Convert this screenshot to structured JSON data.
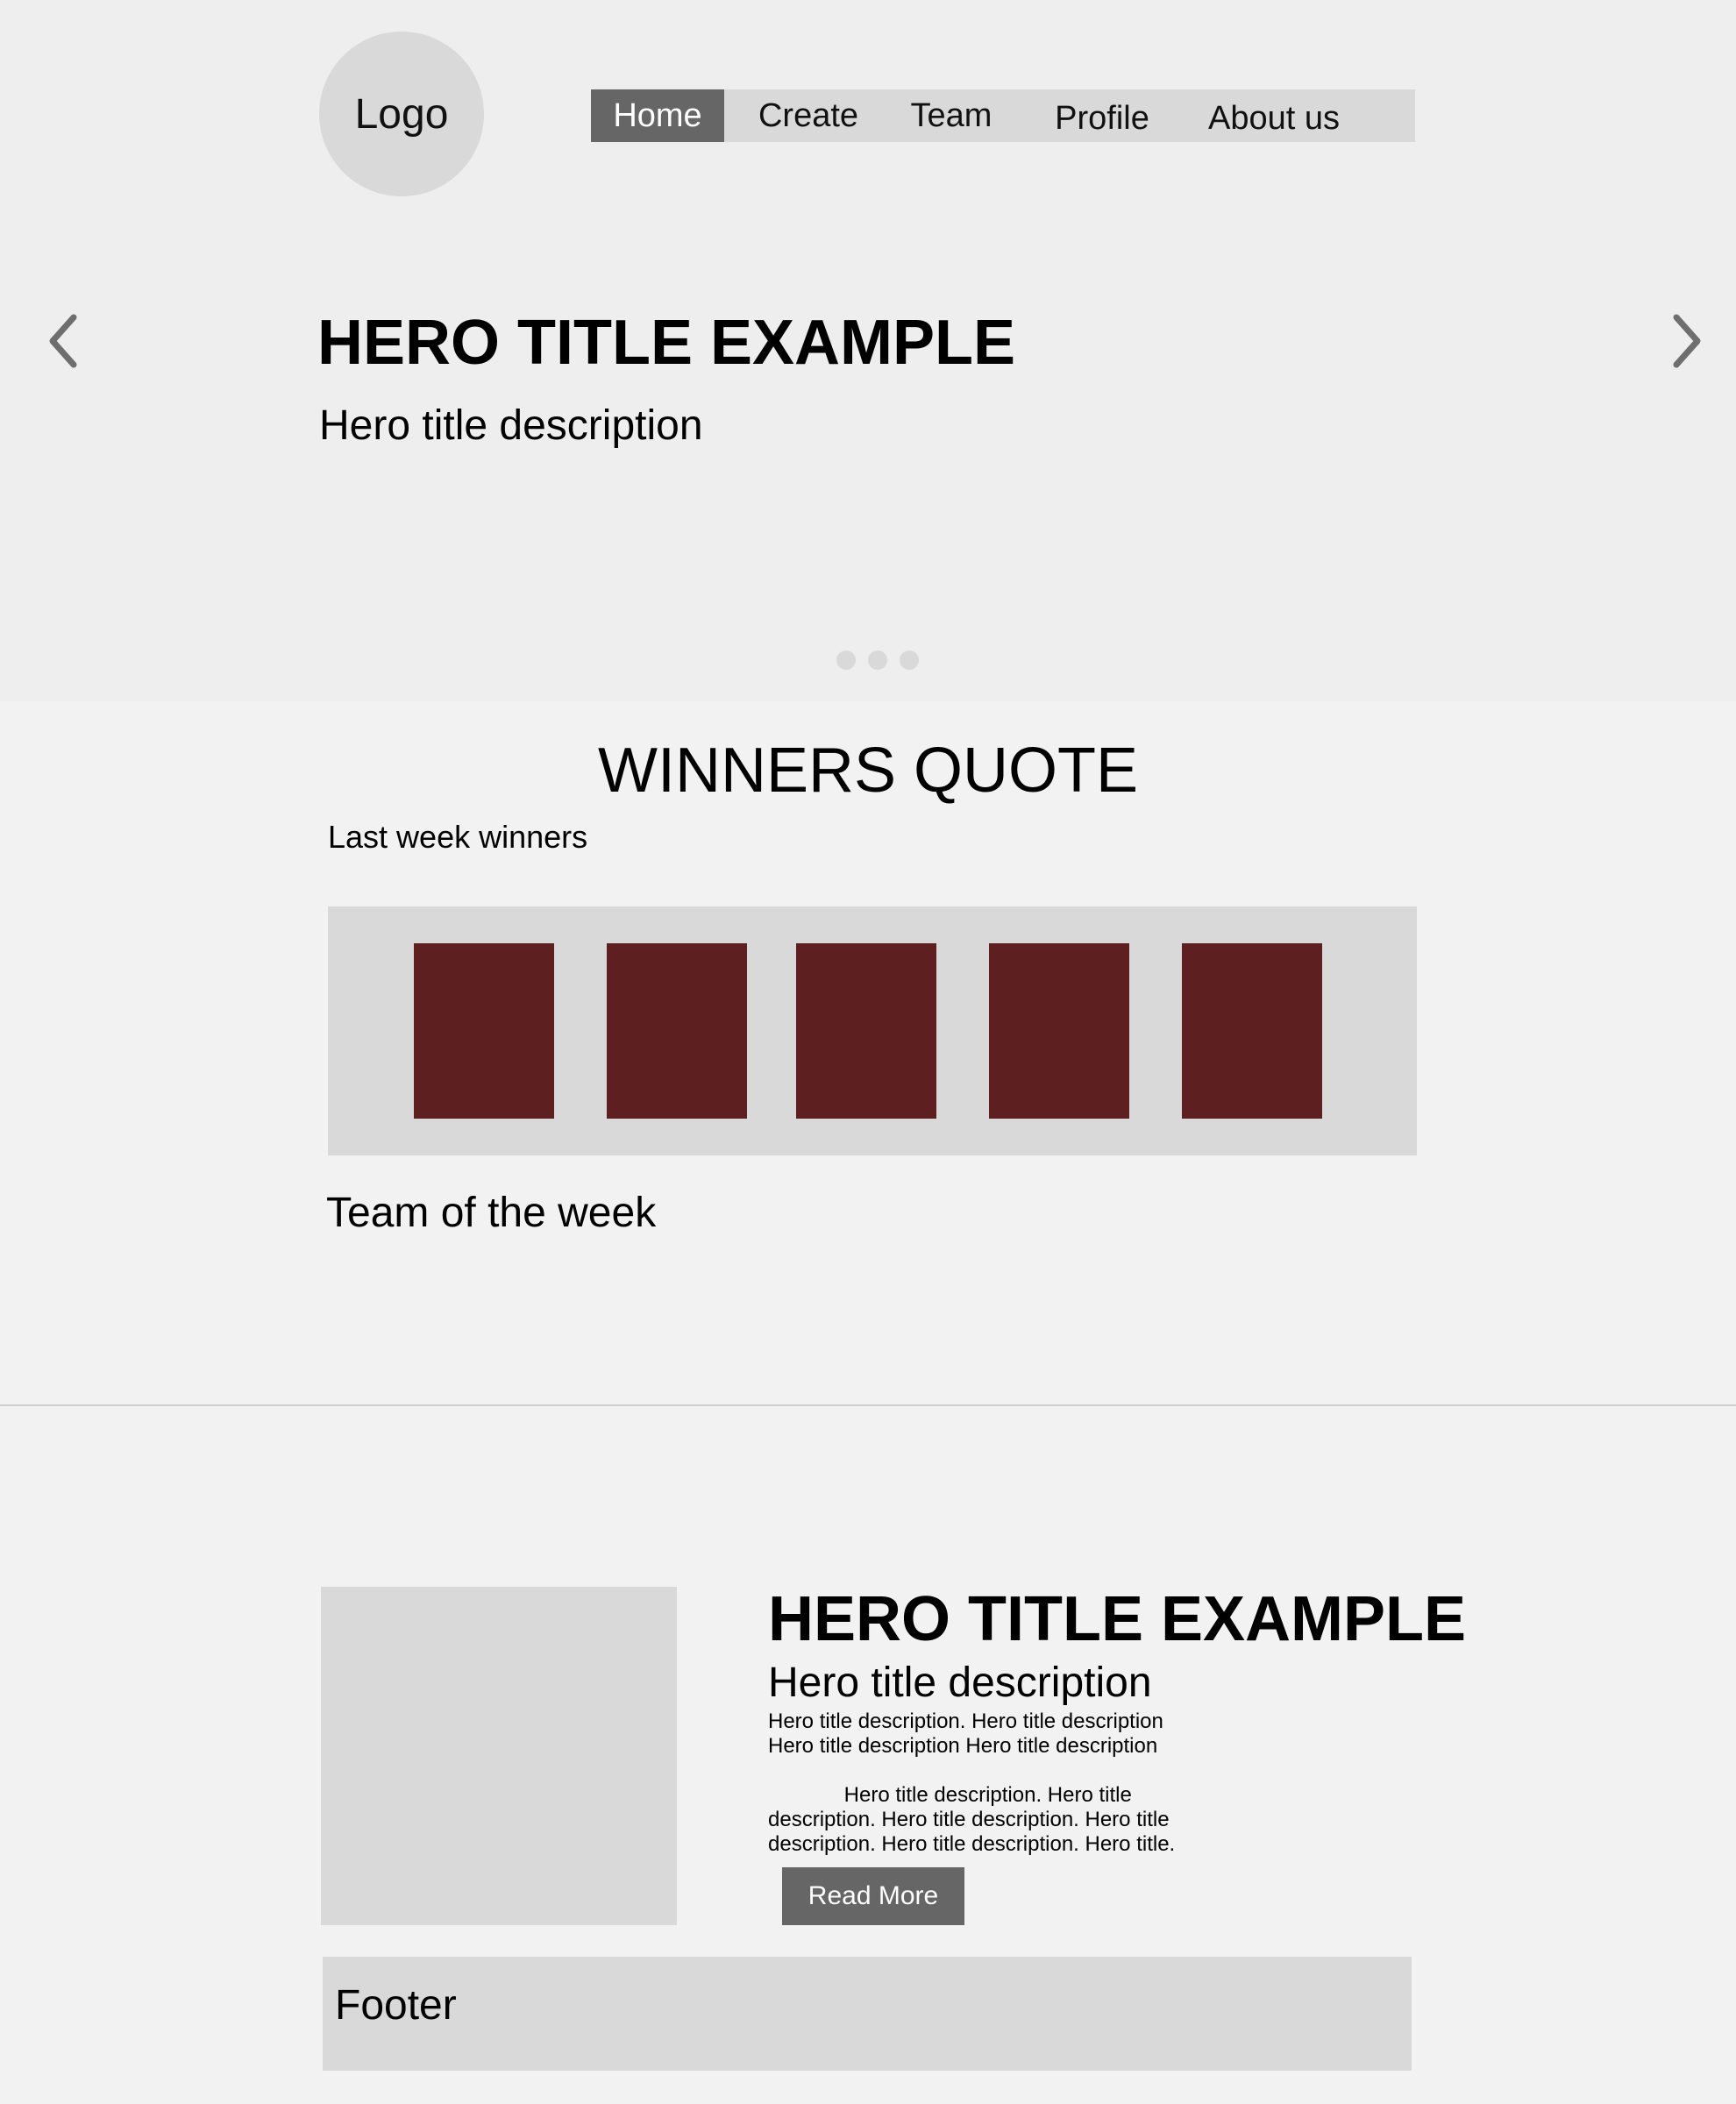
{
  "header": {
    "logo_label": "Logo",
    "nav": [
      {
        "label": "Home",
        "active": true
      },
      {
        "label": "Create",
        "active": false
      },
      {
        "label": "Team",
        "active": false
      },
      {
        "label": "Profile",
        "active": false
      },
      {
        "label": "About us",
        "active": false
      }
    ]
  },
  "hero": {
    "title": "HERO TITLE EXAMPLE",
    "description": "Hero title description",
    "prev_icon": "chevron-left-icon",
    "next_icon": "chevron-right-icon",
    "slide_count": 3
  },
  "winners": {
    "title": "WINNERS QUOTE",
    "subtitle": "Last week winners",
    "card_count": 5,
    "card_color": "#5e1f21",
    "team_of_week_label": "Team of the week"
  },
  "article": {
    "title": "HERO TITLE EXAMPLE",
    "subtitle": "Hero title description",
    "body": "Hero title description. Hero title description\nHero title description Hero title description\n\n             Hero title description. Hero title\ndescription. Hero title description. Hero title\ndescription. Hero title description. Hero title.",
    "read_more_label": "Read More"
  },
  "footer": {
    "label": "Footer"
  },
  "colors": {
    "hero_bg": "#eeeeee",
    "page_bg": "#f2f2f2",
    "placeholder": "#d9d9d9",
    "active_nav": "#666666",
    "accent_card": "#5e1f21"
  }
}
